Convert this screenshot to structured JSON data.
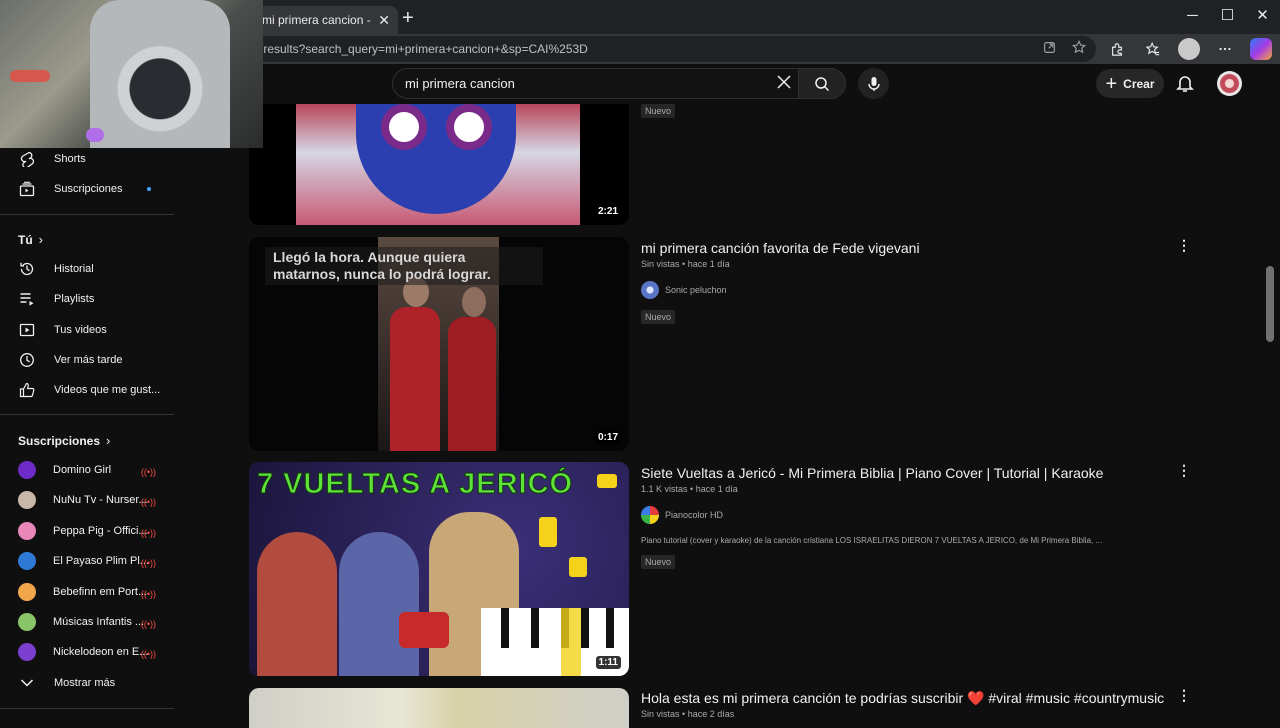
{
  "browser": {
    "tab_title": "mi primera cancion - YouTube",
    "tab_close": "✕",
    "new_tab": "+",
    "url": "/results?search_query=mi+primera+cancion+&sp=CAI%253D",
    "window_minimize": "─",
    "window_maximize": "☐",
    "window_close": "✕"
  },
  "header": {
    "search_value": "mi primera cancion",
    "create_label": "Crear"
  },
  "sidebar": {
    "items": [
      {
        "label": "Shorts"
      },
      {
        "label": "Suscripciones"
      }
    ],
    "you_heading": "Tú",
    "you_items": [
      {
        "label": "Historial"
      },
      {
        "label": "Playlists"
      },
      {
        "label": "Tus videos"
      },
      {
        "label": "Ver más tarde"
      },
      {
        "label": "Videos que me gust..."
      }
    ],
    "subs_heading": "Suscripciones",
    "subscriptions": [
      {
        "label": "Domino Girl",
        "color": "#6e2bc7"
      },
      {
        "label": "NuNu Tv - Nurser...",
        "color": "#c9b8a8"
      },
      {
        "label": "Peppa Pig - Offici...",
        "color": "#e987b9"
      },
      {
        "label": "El Payaso Plim Pl...",
        "color": "#2f79d6"
      },
      {
        "label": "Bebefinn em Port...",
        "color": "#f1a64a"
      },
      {
        "label": "Músicas Infantis ...",
        "color": "#8bc56a"
      },
      {
        "label": "Nickelodeon en E...",
        "color": "#7b3fd0"
      }
    ],
    "show_more": "Mostrar más",
    "live_glyph": "((•))"
  },
  "results": [
    {
      "badge": "Nuevo",
      "duration": "2:21"
    },
    {
      "title": "mi primera canción favorita de Fede vigevani",
      "views": "Sin vistas",
      "age": "hace 1 día",
      "channel": "Sonic peluchon",
      "badge": "Nuevo",
      "duration": "0:17",
      "overlay_text": "Llegó la hora. Aunque quiera matarnos, nunca lo podrá lograr."
    },
    {
      "title": "Siete Vueltas a Jericó - Mi Primera Biblia | Piano Cover | Tutorial | Karaoke",
      "views": "1.1 K vistas",
      "age": "hace 1 día",
      "channel": "Pianocolor HD",
      "description": "Piano tutorial (cover y karaoke) de la canción cristiana LOS ISRAELITAS DIERON 7 VUELTAS A JERICO, de Mi Primera Biblia, ...",
      "badge": "Nuevo",
      "duration": "1:11",
      "thumb_text": "7 VUELTAS A JERICÓ"
    },
    {
      "title": "Hola esta es mi primera canción te podrías suscribir ❤️ #viral #music #countrymusic",
      "views": "Sin vistas",
      "age": "hace 2 días"
    }
  ],
  "meta_separator": "•",
  "kebab": "⋮"
}
